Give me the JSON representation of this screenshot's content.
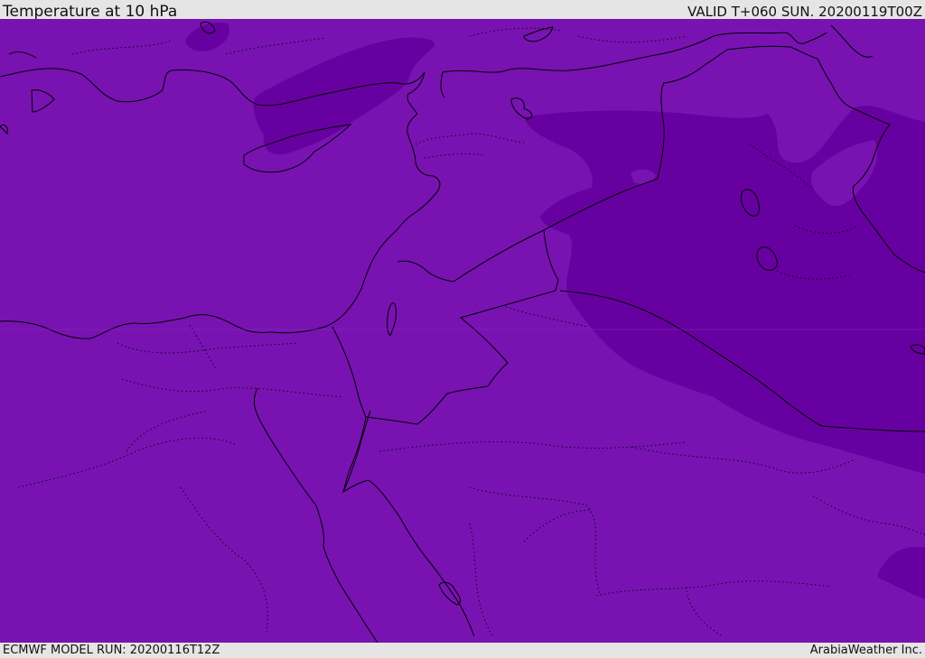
{
  "header": {
    "title": "Temperature at 10 hPa",
    "valid": "VALID T+060 SUN. 20200119T00Z"
  },
  "footer": {
    "model_run": "ECMWF MODEL RUN: 20200116T12Z",
    "brand": "ArabiaWeather Inc."
  },
  "map": {
    "colors": {
      "base_fill": "#7813b2",
      "cold_fill": "#6700a0",
      "border": "#000000"
    }
  }
}
